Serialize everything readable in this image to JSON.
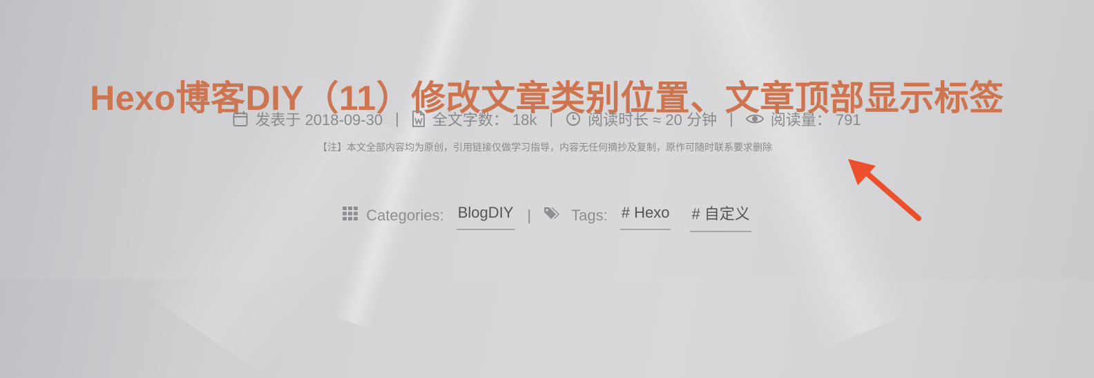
{
  "post": {
    "title": "Hexo博客DIY（11）修改文章类别位置、文章顶部显示标签",
    "meta": {
      "posted": "发表于 2018-09-30",
      "word_count": "全文字数： 18k",
      "reading_time": "阅读时长 ≈ 20 分钟",
      "views": "阅读量： 791",
      "separator": "|"
    },
    "note": "【注】本文全部内容均为原创，引用链接仅做学习指导，内容无任何摘抄及复制，原作可随时联系要求删除",
    "categories_label": "Categories:",
    "categories": [
      "BlogDIY"
    ],
    "tags_label": "Tags:",
    "tags": [
      "# Hexo",
      "# 自定义"
    ]
  },
  "icons": {
    "calendar": "calendar-icon",
    "word": "word-document-icon",
    "clock": "clock-icon",
    "eye": "eye-icon",
    "grid": "th-grid-icon",
    "tags": "tags-icon",
    "arrow": "arrow-annotation"
  },
  "colors": {
    "title": "#cd7450",
    "meta_text": "#8a8a8e",
    "chip_text": "#555558",
    "arrow": "#ec4f2c"
  }
}
